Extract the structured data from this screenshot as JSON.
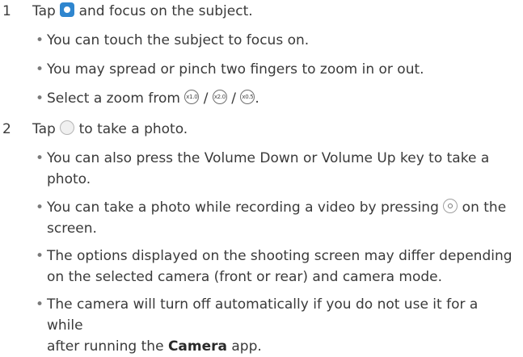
{
  "steps": [
    {
      "number": "1",
      "text_before": "Tap",
      "text_after": "and focus on the subject.",
      "bullets": [
        "You can touch the subject to focus on.",
        "You may spread or pinch two fingers to zoom in or out."
      ],
      "zoom_bullet": {
        "prefix": "Select a zoom from",
        "sep": "/",
        "end": ".",
        "zoom_levels": [
          "x1.0",
          "x2.0",
          "x0.5"
        ]
      }
    },
    {
      "number": "2",
      "text_before": "Tap",
      "text_after": "to take a photo.",
      "bullets": [
        {
          "line1": "You can also press the Volume Down or Volume Up key to take a",
          "line2": "photo."
        },
        {
          "before": "You can take a photo while recording a video by pressing",
          "after": "on the",
          "line2": "screen."
        },
        {
          "line1": "The options displayed on the shooting screen may differ depending",
          "line2": "on the selected camera (front or rear) and camera mode."
        },
        {
          "line1": "The camera will turn off automatically if you do not use it for a while",
          "line2_before": "after running the",
          "line2_bold": "Camera",
          "line2_after": "app."
        }
      ]
    }
  ],
  "icons": {
    "camera_mode": "camera-mode-icon",
    "shutter": "shutter-button-icon",
    "snapshot": "snapshot-camera-icon"
  },
  "colors": {
    "accent": "#2f86cf",
    "text": "#3a3a3a"
  }
}
